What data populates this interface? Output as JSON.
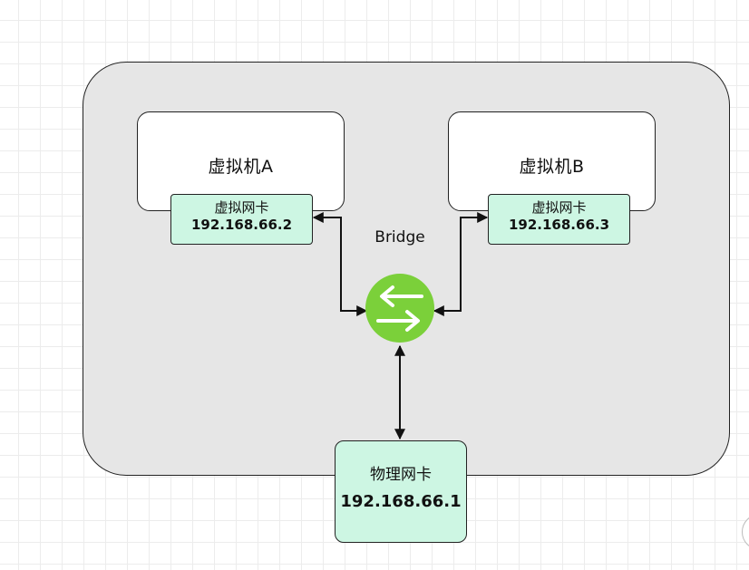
{
  "diagram": {
    "host": {},
    "vm_a": {
      "title": "虚拟机A",
      "nic": {
        "name": "虚拟网卡",
        "ip": "192.168.66.2"
      }
    },
    "vm_b": {
      "title": "虚拟机B",
      "nic": {
        "name": "虚拟网卡",
        "ip": "192.168.66.3"
      }
    },
    "bridge": {
      "label": "Bridge",
      "color": "#7bd03a"
    },
    "physical_nic": {
      "name": "物理网卡",
      "ip": "192.168.66.1"
    },
    "colors": {
      "host_fill": "#e6e6e6",
      "nic_fill": "#cdf6e3",
      "line": "#111111"
    }
  }
}
